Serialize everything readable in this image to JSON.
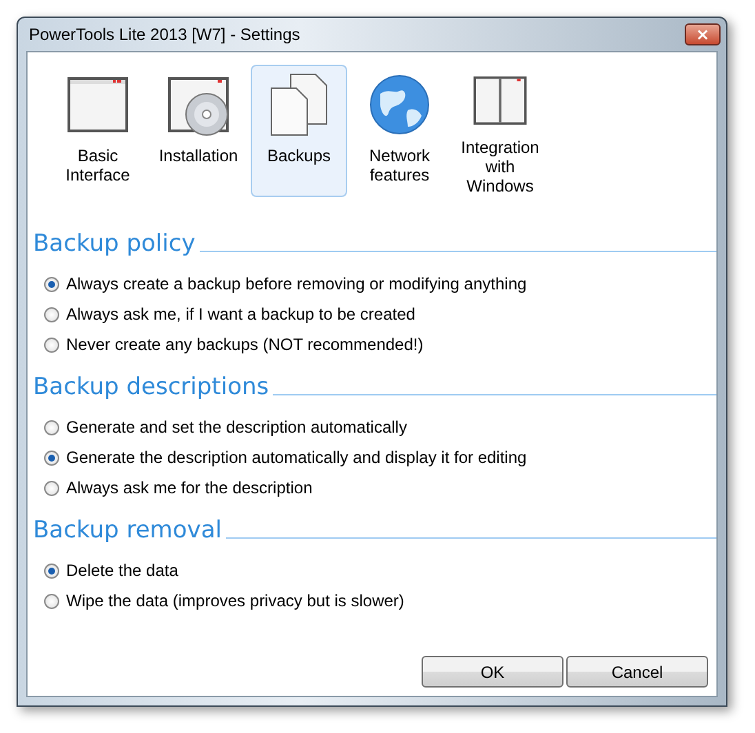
{
  "window": {
    "title": "PowerTools Lite 2013 [W7] - Settings",
    "close_label": "×"
  },
  "categories": [
    {
      "kind": "window",
      "label": "Basic Interface",
      "selected": false
    },
    {
      "kind": "disc",
      "label": "Installation",
      "selected": false
    },
    {
      "kind": "documents",
      "label": "Backups",
      "selected": true
    },
    {
      "kind": "globe",
      "label": "Network features",
      "selected": false
    },
    {
      "kind": "split",
      "label": "Integration with Windows",
      "selected": false
    }
  ],
  "sections": [
    {
      "heading": "Backup policy",
      "options": [
        {
          "label": "Always create a backup before removing or modifying anything",
          "selected": true
        },
        {
          "label": "Always ask me, if I want a backup to be created",
          "selected": false
        },
        {
          "label": "Never create any backups (NOT recommended!)",
          "selected": false
        }
      ]
    },
    {
      "heading": "Backup descriptions",
      "options": [
        {
          "label": "Generate and set the description automatically",
          "selected": false
        },
        {
          "label": "Generate the description automatically and display it for editing",
          "selected": true
        },
        {
          "label": "Always ask me for the description",
          "selected": false
        }
      ]
    },
    {
      "heading": "Backup removal",
      "options": [
        {
          "label": "Delete the data",
          "selected": true
        },
        {
          "label": "Wipe the data (improves privacy but is slower)",
          "selected": false
        }
      ]
    }
  ],
  "buttons": [
    "OK",
    "Cancel"
  ]
}
